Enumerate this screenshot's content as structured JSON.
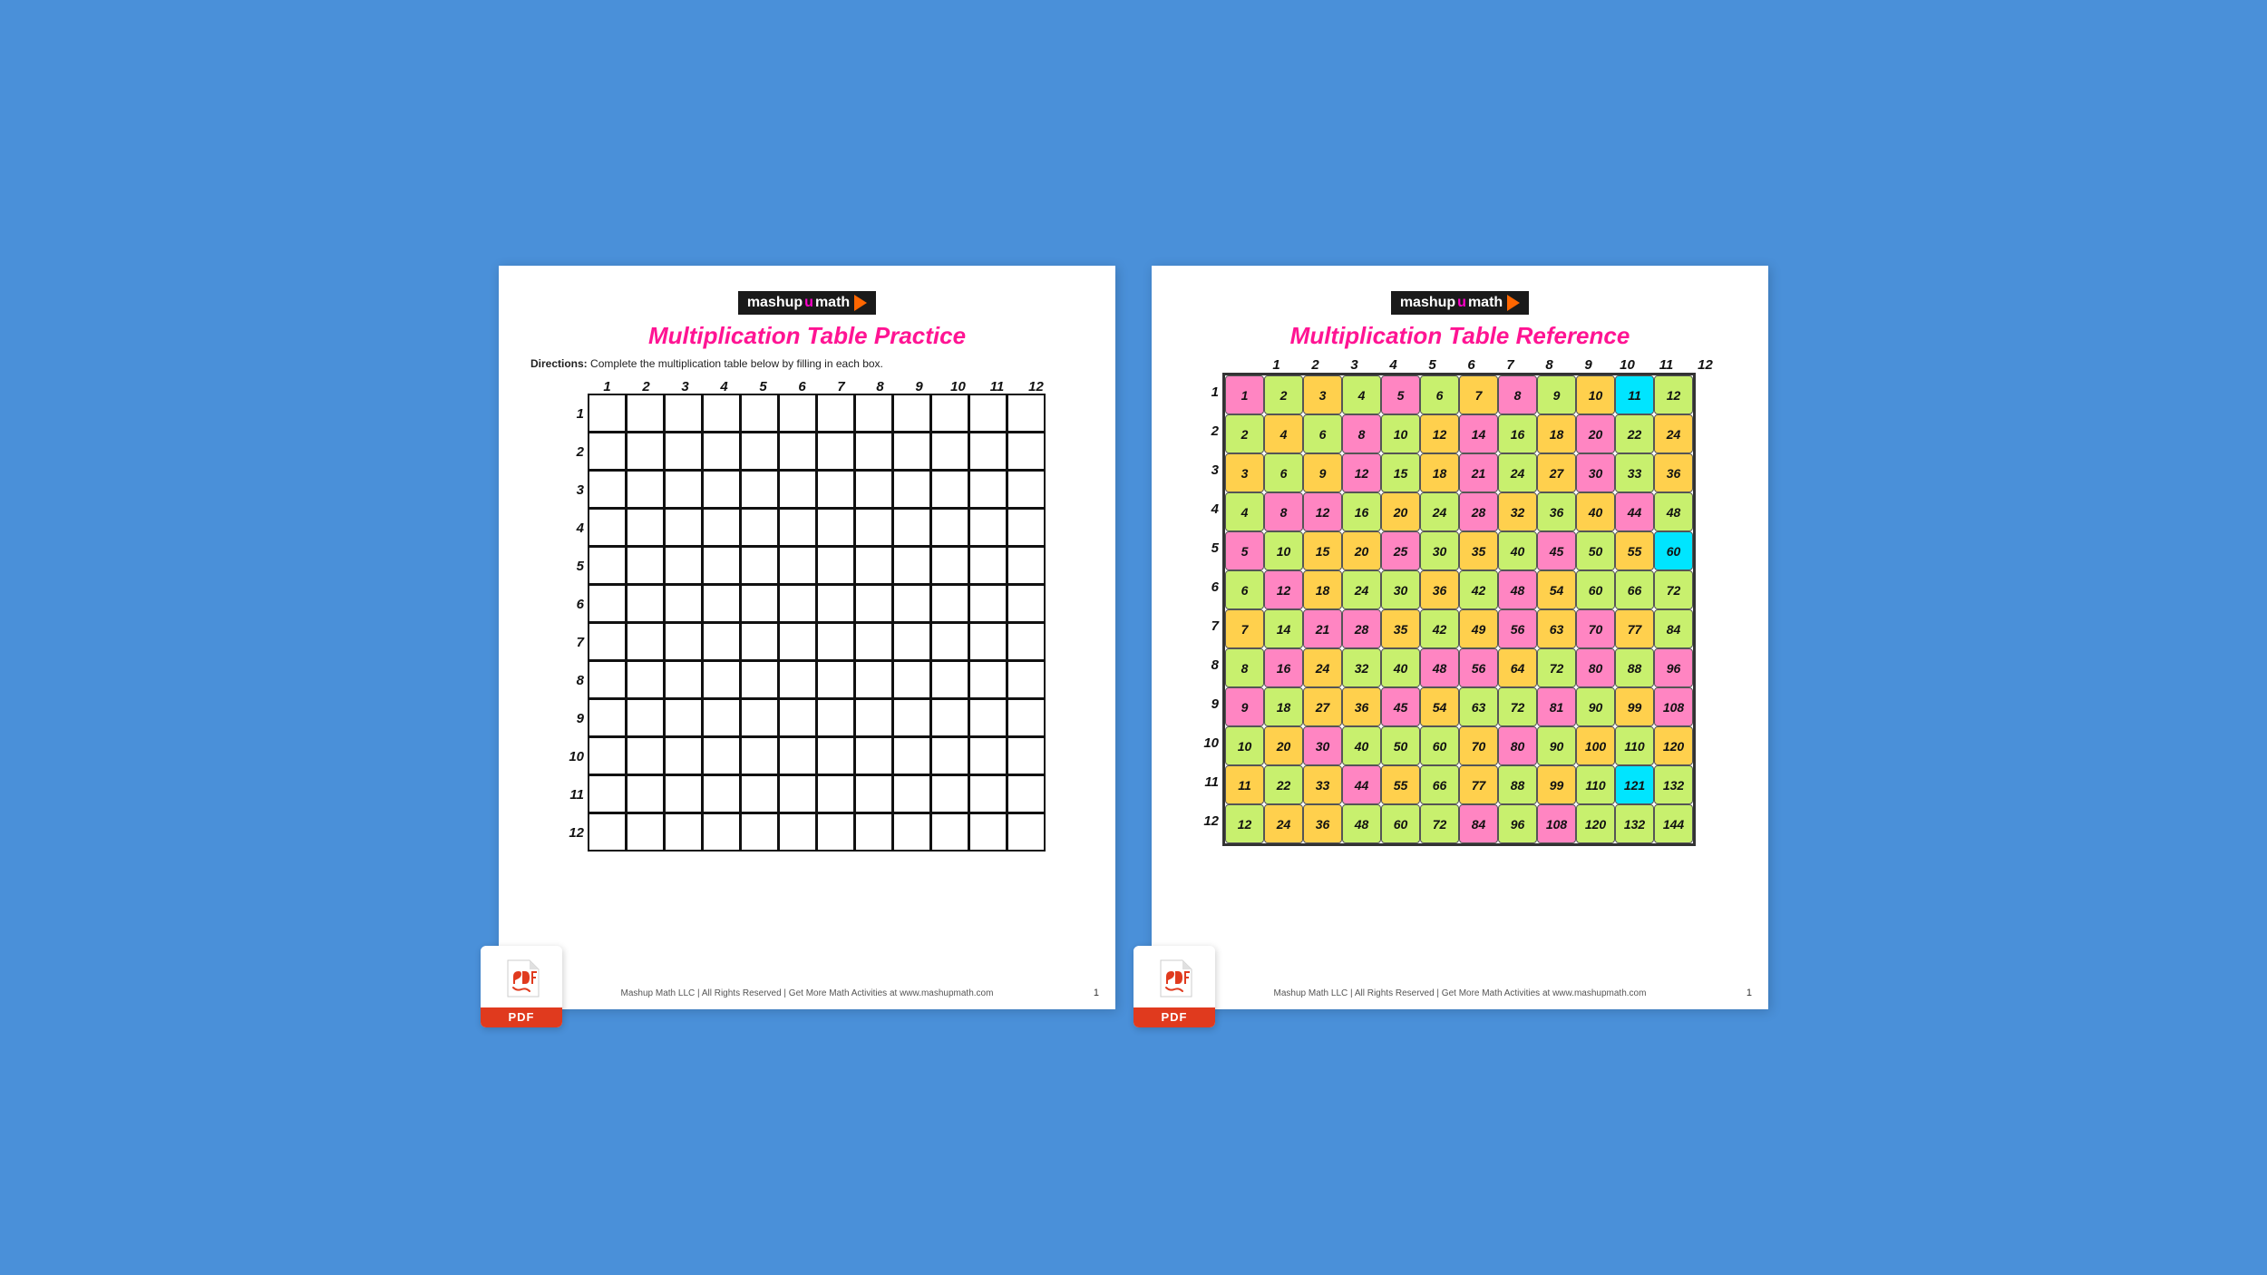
{
  "page1": {
    "logo": "mashupmath▶",
    "title": "Multiplication Table Practice",
    "directions_label": "Directions:",
    "directions_text": "Complete the multiplication table below by filling in each box.",
    "col_headers": [
      "1",
      "2",
      "3",
      "4",
      "5",
      "6",
      "7",
      "8",
      "9",
      "10",
      "11",
      "12"
    ],
    "row_headers": [
      "1",
      "2",
      "3",
      "4",
      "5",
      "6",
      "7",
      "8",
      "9",
      "10",
      "11",
      "12"
    ],
    "footer": "Mashup Math LLC | All Rights Reserved | Get More Math Activities at www.mashupmath.com",
    "page_number": "1",
    "pdf_label": "PDF"
  },
  "page2": {
    "logo": "mashupmath▶",
    "title": "Multiplication Table Reference",
    "col_headers": [
      "1",
      "2",
      "3",
      "4",
      "5",
      "6",
      "7",
      "8",
      "9",
      "10",
      "11",
      "12"
    ],
    "row_headers": [
      "1",
      "2",
      "3",
      "4",
      "5",
      "6",
      "7",
      "8",
      "9",
      "10",
      "11",
      "12"
    ],
    "table_data": [
      [
        1,
        2,
        3,
        4,
        5,
        6,
        7,
        8,
        9,
        10,
        11,
        12
      ],
      [
        2,
        4,
        6,
        8,
        10,
        12,
        14,
        16,
        18,
        20,
        22,
        24
      ],
      [
        3,
        6,
        9,
        12,
        15,
        18,
        21,
        24,
        27,
        30,
        33,
        36
      ],
      [
        4,
        8,
        12,
        16,
        20,
        24,
        28,
        32,
        36,
        40,
        44,
        48
      ],
      [
        5,
        10,
        15,
        20,
        25,
        30,
        35,
        40,
        45,
        50,
        55,
        60
      ],
      [
        6,
        12,
        18,
        24,
        30,
        36,
        42,
        48,
        54,
        60,
        66,
        72
      ],
      [
        7,
        14,
        21,
        28,
        35,
        42,
        49,
        56,
        63,
        70,
        77,
        84
      ],
      [
        8,
        16,
        24,
        32,
        40,
        48,
        56,
        64,
        72,
        80,
        88,
        96
      ],
      [
        9,
        18,
        27,
        36,
        45,
        54,
        63,
        72,
        81,
        90,
        99,
        108
      ],
      [
        10,
        20,
        30,
        40,
        50,
        60,
        70,
        80,
        90,
        100,
        110,
        120
      ],
      [
        11,
        22,
        33,
        44,
        55,
        66,
        77,
        88,
        99,
        110,
        121,
        132
      ],
      [
        12,
        24,
        36,
        48,
        60,
        72,
        84,
        96,
        108,
        120,
        132,
        144
      ]
    ],
    "footer": "Mashup Math LLC | All Rights Reserved | Get More Math Activities at www.mashupmath.com",
    "page_number": "1",
    "pdf_label": "PDF"
  },
  "colors": {
    "col1": "#ff85c2",
    "col2": "#c8f06e",
    "col3": "#ffd04d",
    "col4": "#c8f06e",
    "col5": "#ff85c2",
    "col6": "#c8f06e",
    "col7": "#ffd04d",
    "col8": "#ff85c2",
    "col9": "#c8f06e",
    "col10": "#ffd04d",
    "col11": "#00e5ff",
    "col12": "#c8f06e"
  }
}
